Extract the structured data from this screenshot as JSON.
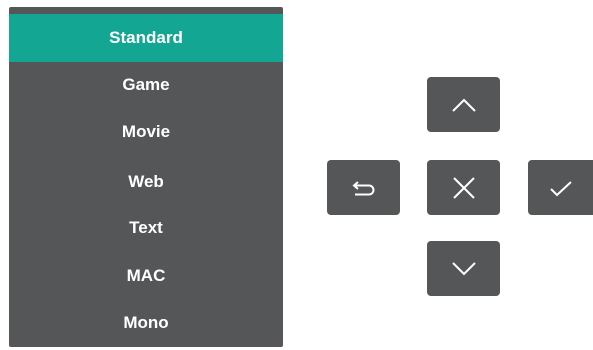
{
  "menu": {
    "items": [
      {
        "label": "Standard",
        "selected": true
      },
      {
        "label": "Game",
        "selected": false
      },
      {
        "label": "Movie",
        "selected": false
      },
      {
        "label": "Web",
        "selected": false
      },
      {
        "label": "Text",
        "selected": false
      },
      {
        "label": "MAC",
        "selected": false
      },
      {
        "label": "Mono",
        "selected": false
      }
    ]
  },
  "controls": {
    "up": {
      "icon": "chevron-up-icon"
    },
    "back": {
      "icon": "return-icon"
    },
    "close": {
      "icon": "close-icon"
    },
    "confirm": {
      "icon": "checkmark-icon"
    },
    "down": {
      "icon": "chevron-down-icon"
    }
  },
  "colors": {
    "panel": "#555657",
    "accent": "#13a693",
    "text": "#ffffff"
  }
}
